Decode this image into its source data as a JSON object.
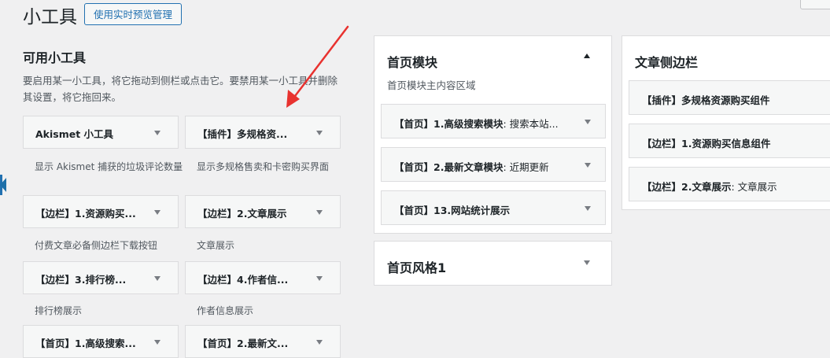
{
  "header": {
    "title": "小工具",
    "live_preview_button": "使用实时预览管理"
  },
  "available": {
    "title": "可用小工具",
    "description": "要启用某一小工具，将它拖动到侧栏或点击它。要禁用某一小工具并删除其设置，将它拖回来。",
    "widgets": [
      {
        "label": "Akismet 小工具",
        "desc": "显示 Akismet 捕获的垃圾评论数量"
      },
      {
        "label": "【插件】多规格资...",
        "desc": "显示多规格售卖和卡密购买界面"
      },
      {
        "label": "【边栏】1.资源购买...",
        "desc": "付费文章必备侧边栏下载按钮"
      },
      {
        "label": "【边栏】2.文章展示",
        "desc": "文章展示"
      },
      {
        "label": "【边栏】3.排行榜...",
        "desc": "排行榜展示"
      },
      {
        "label": "【边栏】4.作者信...",
        "desc": "作者信息展示"
      },
      {
        "label": "【首页】1.高级搜索...",
        "desc": ""
      },
      {
        "label": "【首页】2.最新文...",
        "desc": ""
      }
    ]
  },
  "home_module": {
    "title": "首页模块",
    "description": "首页模块主内容区域",
    "widgets": [
      {
        "label": "【首页】1.高级搜索模块",
        "sub": ": 搜索本站..."
      },
      {
        "label": "【首页】2.最新文章模块",
        "sub": ": 近期更新"
      },
      {
        "label": "【首页】13.网站统计展示",
        "sub": ""
      }
    ]
  },
  "home_style": {
    "title": "首页风格1"
  },
  "article_sidebar": {
    "title": "文章侧边栏",
    "widgets": [
      {
        "label": "【插件】多规格资源购买组件",
        "sub": ""
      },
      {
        "label": "【边栏】1.资源购买信息组件",
        "sub": ""
      },
      {
        "label": "【边栏】2.文章展示",
        "sub": ": 文章展示"
      }
    ]
  },
  "colors": {
    "accent": "#2271b1",
    "annotation_arrow": "#e8322f",
    "background": "#f0f0f1"
  },
  "icons": [
    "chevron-down-icon",
    "chevron-up-icon",
    "annotation-arrow-icon",
    "collapse-handle-icon"
  ]
}
